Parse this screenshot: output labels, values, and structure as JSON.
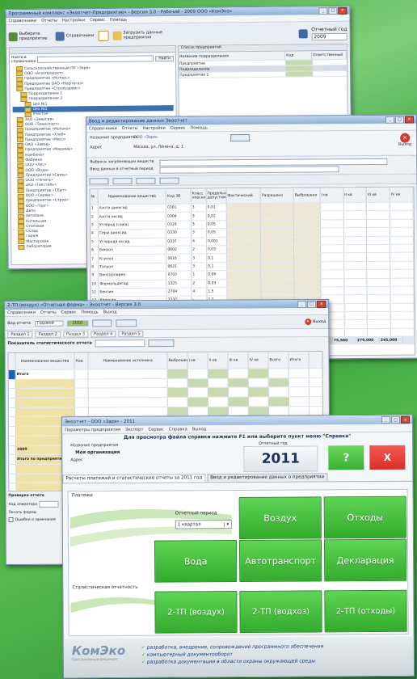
{
  "win1": {
    "title": "Программный комплекс «Экоотчет-Предприятие» - Версия 3.0 - Рабочий - 2009 ООО «КомЭко»",
    "menu": [
      "Справочники",
      "Отчеты",
      "Настройки",
      "Сервис",
      "Помощь"
    ],
    "toolbar": {
      "enterprise": "Выберите предприятие",
      "catalogs": "Справочники",
      "load_report": "Загрузить данные предприятия",
      "period_label": "Отчетный год",
      "period_value": "2009"
    },
    "search_label": "Найти в справочнике",
    "search_button": "Найти",
    "tree_items": [
      "Сельскохозяйственный ПК «Заря»",
      "ООО «Агропродукт»",
      "Предприятие «Моторс»",
      "Предприятие ОАО «Нефтегаз»",
      "Предприятие «Стройсервис»",
      "Подразделение 1",
      "Подразделение 2",
      "Цех №1",
      "Цех №2",
      "Участок",
      "ЗАО «Энергия»",
      "ООО «Транспорт»",
      "Предприятие «Молоко»",
      "Предприятие «Хлеб»",
      "Предприятие «Мясо»",
      "ОАО «Завод»",
      "Предприятие «Машины»",
      "Комбинат",
      "Фабрика",
      "ООО «Лес»",
      "ООО «Вода»",
      "Предприятие «Связь»",
      "ООО «Печать»",
      "ЗАО «Текстиль»",
      "Предприятие «Сбыт»",
      "ООО «Сервис»",
      "Предприятие «Строй»",
      "ООО «Торг»",
      "Депо",
      "Автобаза",
      "Котельная",
      "Столовая",
      "Склад",
      "Гараж",
      "Мастерская",
      "Лаборатория"
    ],
    "right_header": "Список предприятий",
    "right_cols": [
      "Название подразделения",
      "Код",
      "Ответственный"
    ],
    "right_rows": [
      "Предприятие",
      "Подразделение",
      "Предприятие 1"
    ]
  },
  "win2": {
    "title": "Ввод и редактирование данных Экоотчет",
    "menu": [
      "Справочники",
      "Отчеты",
      "Настройки",
      "Сервис",
      "Помощь"
    ],
    "company_label": "Название предприятия",
    "company_value": "ООО «Заря»",
    "address_label": "Адрес",
    "address_value": "Москва, ул. Ленина, д. 1",
    "exit_label": "Выход",
    "period_label": "Ввод данных в отчетный период",
    "subtab": "Выбросы загрязняющих веществ",
    "cols": [
      "№",
      "Наименование вещества",
      "Код ЗВ",
      "Класс опасности",
      "Предельно допустимые",
      "Фактический",
      "Разрешено",
      "Выброшено",
      "I кв",
      "II кв",
      "III кв",
      "IV кв"
    ],
    "rows": [
      {
        "n": "1",
        "name": "Азота диоксид",
        "code": "0301",
        "cls": "3",
        "v": "0,01"
      },
      {
        "n": "2",
        "name": "Азота оксид",
        "code": "0304",
        "cls": "3",
        "v": "0,02"
      },
      {
        "n": "3",
        "name": "Углерод (сажа)",
        "code": "0328",
        "cls": "3",
        "v": "0,05"
      },
      {
        "n": "4",
        "name": "Серы диоксид",
        "code": "0330",
        "cls": "3",
        "v": "0,05"
      },
      {
        "n": "5",
        "name": "Углерода оксид",
        "code": "0337",
        "cls": "4",
        "v": "0,001"
      },
      {
        "n": "6",
        "name": "Бензол",
        "code": "0602",
        "cls": "2",
        "v": "0,03"
      },
      {
        "n": "7",
        "name": "Ксилол",
        "code": "0616",
        "cls": "3",
        "v": "0,1"
      },
      {
        "n": "8",
        "name": "Толуол",
        "code": "0621",
        "cls": "3",
        "v": "0,1"
      },
      {
        "n": "9",
        "name": "Бенз(а)пирен",
        "code": "0703",
        "cls": "1",
        "v": "0,08"
      },
      {
        "n": "10",
        "name": "Формальдегид",
        "code": "1325",
        "cls": "2",
        "v": "0,03"
      },
      {
        "n": "11",
        "name": "Бензин",
        "code": "2704",
        "cls": "4",
        "v": "1,5"
      },
      {
        "n": "12",
        "name": "Керосин",
        "code": "2732",
        "cls": "-",
        "v": "1,2"
      },
      {
        "n": "13",
        "name": "Пыль неорганическая",
        "code": "2908",
        "cls": "3",
        "v": "0,15"
      },
      {
        "n": "14",
        "name": "Взвешенные вещества",
        "code": "2902",
        "cls": "3",
        "v": "0,15"
      },
      {
        "n": "15",
        "name": "Сероводород",
        "code": "0333",
        "cls": "2",
        "v": "0,008"
      },
      {
        "n": "16",
        "name": "Аммиак",
        "code": "0303",
        "cls": "4",
        "v": "0,04"
      }
    ],
    "total_label": "Итого",
    "totals": [
      "75,560",
      "279,000",
      "245,000"
    ]
  },
  "win3": {
    "title": "2-ТП (воздух) «Отчетная форма» - Экоотчет - Версия 3.0",
    "menu": [
      "Справочники",
      "Отчеты",
      "Сервис",
      "Помощь",
      "Выход"
    ],
    "kind_label": "Вид отчета",
    "kind_value": "Годовой",
    "period_value": "2010",
    "exit_label": "Выход",
    "tabs": [
      "Раздел 1",
      "Раздел 2",
      "Раздел 3",
      "Раздел 4",
      "Раздел 5"
    ],
    "section_label": "Показатель статистического отчета",
    "cols": [
      "Наименование вещества",
      "Код",
      "Наименование источника",
      "Выброшено",
      "I кв",
      "II кв",
      "III кв",
      "IV кв",
      "Всего",
      "Итого"
    ],
    "left_rows": [
      "Итого",
      "",
      "",
      "",
      "",
      "",
      "",
      "",
      "2009",
      "Итого по предприятию",
      "",
      "",
      "",
      "Итого по предприятию"
    ],
    "bottom_labels": [
      "Проверка отчета",
      "Код оператора",
      "Печать формы",
      "Ошибки и замечания"
    ]
  },
  "win4": {
    "title": "Экоотчет - ООО «Заря» - 2011",
    "menu": [
      "Параметры предприятия",
      "Экспорт",
      "Сервис",
      "Справка",
      "Выход"
    ],
    "banner": "Для просмотра файла справки нажмите F1 или выберите пункт меню \"Справка\"",
    "company_label": "Название предприятия",
    "company_value": "Моя организация",
    "address_label": "Адрес",
    "year_label": "Отчетный год",
    "year": "2011",
    "help_button": "?",
    "close_button": "X",
    "tab_active": "Расчеты платежей и статистические отчеты за 2011 год",
    "tab_other": "Ввод и редактирование данных о предприятии",
    "payments_label": "Платежи",
    "period_label": "Отчетный период",
    "period_value": "1 квартал",
    "tiles_pay": [
      "Воздух",
      "Отходы",
      "Вода",
      "Автотранспорт",
      "Декларация"
    ],
    "stats_label": "Статистическая отчетность",
    "tiles_stat": [
      "2-ТП (воздух)",
      "2-ТП (водхоз)",
      "2-ТП (отходы)"
    ],
    "logo": "КомЭко",
    "logo_sub": "Программные решения",
    "slogans": [
      "разработка, внедрение, сопровождение программного обеспечения",
      "компьютерный документооборот",
      "разработка документации в области охраны окружающей среды"
    ]
  },
  "colors": {
    "accent_green": "#3fb036",
    "red": "#e53c35",
    "navy": "#1c2f5a"
  }
}
